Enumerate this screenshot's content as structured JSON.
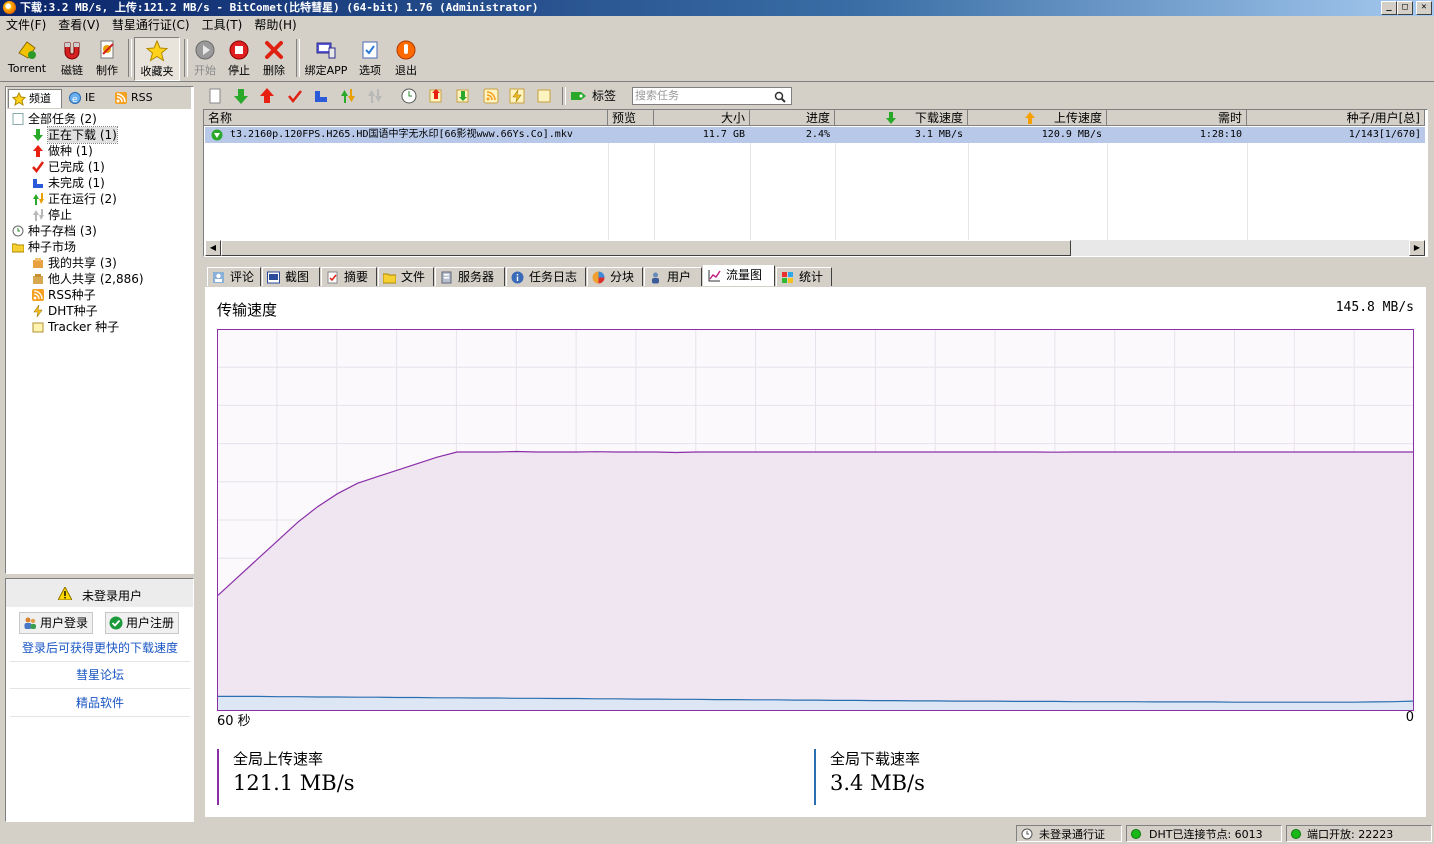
{
  "window": {
    "title": "下载:3.2 MB/s, 上传:121.2 MB/s - BitComet(比特彗星) (64-bit) 1.76 (Administrator)",
    "controls": [
      "_",
      "□",
      "✕"
    ]
  },
  "menu": [
    "文件(F)",
    "查看(V)",
    "彗星通行证(C)",
    "工具(T)",
    "帮助(H)"
  ],
  "toolbar": {
    "torrent": "Torrent",
    "magnet": "磁链",
    "make": "制作",
    "favorites": "收藏夹",
    "start": "开始",
    "stop": "停止",
    "delete": "删除",
    "bind_app": "绑定APP",
    "options": "选项",
    "exit": "退出"
  },
  "left_tabs": [
    "频道",
    "IE",
    "RSS"
  ],
  "tree": [
    {
      "label": "全部任务 (2)",
      "icon": "all-tasks-icon"
    },
    {
      "label": "正在下载 (1)",
      "icon": "download-arrow-icon"
    },
    {
      "label": "做种 (1)",
      "icon": "seed-arrow-icon"
    },
    {
      "label": "已完成 (1)",
      "icon": "check-icon"
    },
    {
      "label": "未完成 (1)",
      "icon": "incomplete-icon"
    },
    {
      "label": "正在运行 (2)",
      "icon": "running-icon"
    },
    {
      "label": "停止",
      "icon": "stopped-icon"
    },
    {
      "label": "种子存档 (3)",
      "icon": "archive-icon"
    },
    {
      "label": "种子市场",
      "icon": "folder-icon"
    },
    {
      "label": "我的共享 (3)",
      "icon": "share-icon"
    },
    {
      "label": "他人共享 (2,886)",
      "icon": "others-share-icon"
    },
    {
      "label": "RSS种子",
      "icon": "rss-icon"
    },
    {
      "label": "DHT种子",
      "icon": "dht-icon"
    },
    {
      "label": "Tracker 种子",
      "icon": "tracker-icon"
    }
  ],
  "userbox": {
    "status": "未登录用户",
    "login": "用户登录",
    "register": "用户注册",
    "links": [
      "登录后可获得更快的下载速度",
      "彗星论坛",
      "精品软件"
    ]
  },
  "task_toolbar": {
    "tag_label": "标签",
    "search_placeholder": "搜索任务"
  },
  "list": {
    "headers": [
      "名称",
      "预览",
      "大小",
      "进度",
      "下载速度",
      "上传速度",
      "需时",
      "种子/用户[总]"
    ],
    "rows": [
      {
        "name": "t3.2160p.120FPS.H265.HD国语中字无水印[66影视www.66Ys.Co].mkv",
        "preview": "",
        "size": "11.7 GB",
        "progress": "2.4%",
        "down": "3.1 MB/s",
        "up": "120.9 MB/s",
        "eta": "1:28:10",
        "peers": "1/143[1/670]"
      }
    ]
  },
  "detail_tabs": [
    "评论",
    "截图",
    "摘要",
    "文件",
    "服务器",
    "任务日志",
    "分块",
    "用户",
    "流量图",
    "统计"
  ],
  "graph": {
    "title": "传输速度",
    "max_label": "145.8 MB/s",
    "left_axis": "60 秒",
    "right_axis": "0",
    "upload_label": "全局上传速率",
    "upload_value": "121.1 MB/s",
    "download_label": "全局下载速率",
    "download_value": "3.4 MB/s",
    "upload_color": "#8b2fa8",
    "download_color": "#2a6fb0",
    "y_max": 145.8,
    "upload_series": [
      44,
      51,
      58,
      65,
      72,
      78,
      83,
      87,
      89.5,
      92,
      94.5,
      97,
      99,
      99,
      99,
      99.2,
      99,
      99,
      99,
      99.1,
      99,
      99,
      99,
      98.8,
      99,
      99,
      99,
      99,
      99,
      99,
      99,
      99,
      99,
      99,
      99,
      99,
      99,
      99,
      99,
      99,
      99,
      99,
      98.9,
      99,
      99,
      99,
      99,
      99,
      99,
      99,
      99,
      99,
      99,
      99,
      99,
      99,
      99,
      99,
      99,
      99,
      99
    ],
    "download_series": [
      5.2,
      5.2,
      5.2,
      5.1,
      5.1,
      5.0,
      5.0,
      4.9,
      4.9,
      4.8,
      4.8,
      4.7,
      4.7,
      4.6,
      4.6,
      4.5,
      4.5,
      4.4,
      4.4,
      4.3,
      4.3,
      4.2,
      4.2,
      4.1,
      4.1,
      4.0,
      4.0,
      3.9,
      3.9,
      3.8,
      3.8,
      3.7,
      3.7,
      3.6,
      3.6,
      3.5,
      3.5,
      3.4,
      3.4,
      3.4,
      3.3,
      3.3,
      3.3,
      3.2,
      3.2,
      3.2,
      3.2,
      3.1,
      3.1,
      3.1,
      3.1,
      3.0,
      3.0,
      3.0,
      3.0,
      3.0,
      3.0,
      3.0,
      3.1,
      3.2,
      3.4
    ]
  },
  "statusbar": {
    "passport": "未登录通行证",
    "dht": "DHT已连接节点:  6013",
    "port": "端口开放:  22223"
  }
}
